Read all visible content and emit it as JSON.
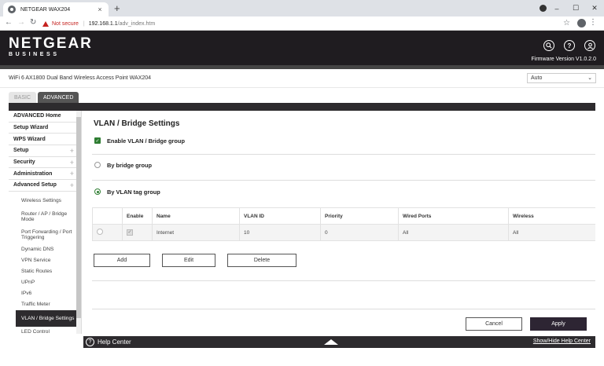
{
  "browser": {
    "tab_title": "NETGEAR WAX204",
    "tab_close": "×",
    "new_tab": "+",
    "not_secure": "Not secure",
    "url_host": "192.168.1.1",
    "url_path": "/adv_index.htm",
    "win_min": "–",
    "win_max": "☐",
    "win_close": "✕"
  },
  "header": {
    "brand": "NETGEAR",
    "brand_sub": "BUSINESS",
    "firmware": "Firmware Version V1.0.2.0"
  },
  "device": {
    "name": "WiFi 6 AX1800 Dual Band Wireless Access Point WAX204",
    "language": "Auto"
  },
  "mode_tabs": {
    "basic": "BASIC",
    "advanced": "ADVANCED"
  },
  "menu": {
    "top": [
      {
        "label": "ADVANCED Home",
        "plus": ""
      },
      {
        "label": "Setup Wizard",
        "plus": ""
      },
      {
        "label": "WPS Wizard",
        "plus": ""
      },
      {
        "label": "Setup",
        "plus": "+"
      },
      {
        "label": "Security",
        "plus": "+"
      },
      {
        "label": "Administration",
        "plus": "+"
      },
      {
        "label": "Advanced Setup",
        "plus": "+"
      }
    ],
    "sub": [
      "Wireless Settings",
      "Router / AP / Bridge Mode",
      "Port Forwarding / Port Triggering",
      "Dynamic DNS",
      "VPN Service",
      "Static Routes",
      "UPnP",
      "IPv6",
      "Traffic Meter",
      "VLAN / Bridge Settings",
      "LED Control"
    ]
  },
  "main": {
    "title": "VLAN / Bridge Settings",
    "enable_label": "Enable VLAN / Bridge group",
    "bridge_label": "By bridge group",
    "vlan_label": "By VLAN tag group",
    "table": {
      "headers": [
        "",
        "Enable",
        "Name",
        "VLAN ID",
        "Priority",
        "Wired Ports",
        "Wireless"
      ],
      "rows": [
        {
          "name": "Internet",
          "vlan_id": "10",
          "priority": "0",
          "wired": "All",
          "wireless": "All"
        }
      ]
    },
    "add": "Add",
    "edit": "Edit",
    "delete": "Delete",
    "cancel": "Cancel",
    "apply": "Apply"
  },
  "help": {
    "label": "Help Center",
    "link": "Show/Hide Help Center"
  }
}
